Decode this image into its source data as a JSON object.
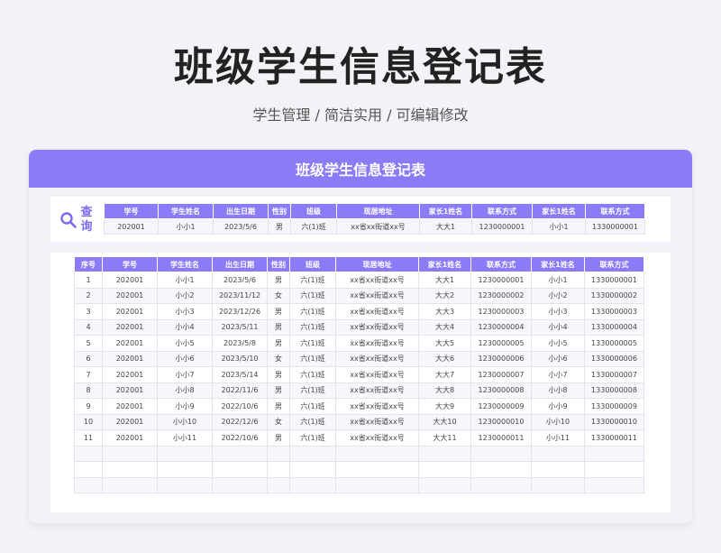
{
  "page": {
    "title": "班级学生信息登记表",
    "subtitle": "学生管理 / 简洁实用 /  可编辑修改"
  },
  "card": {
    "title": "班级学生信息登记表"
  },
  "query": {
    "label": "查询",
    "headers": [
      "学号",
      "学生姓名",
      "出生日期",
      "性别",
      "班级",
      "现居地址",
      "家长1姓名",
      "联系方式",
      "家长1姓名",
      "联系方式"
    ],
    "row": [
      "202001",
      "小小1",
      "2023/5/6",
      "男",
      "六(1)班",
      "xx省xx街道xx号",
      "大大1",
      "1230000001",
      "小小1",
      "1330000001"
    ]
  },
  "table": {
    "headers": [
      "序号",
      "学号",
      "学生姓名",
      "出生日期",
      "性别",
      "班级",
      "现居地址",
      "家长1姓名",
      "联系方式",
      "家长1姓名",
      "联系方式"
    ],
    "rows": [
      [
        "1",
        "202001",
        "小小1",
        "2023/5/6",
        "男",
        "六(1)班",
        "xx省xx街道xx号",
        "大大1",
        "1230000001",
        "小小1",
        "1330000001"
      ],
      [
        "2",
        "202001",
        "小小2",
        "2023/11/12",
        "女",
        "六(1)班",
        "xx省xx街道xx号",
        "大大2",
        "1230000002",
        "小小2",
        "1330000002"
      ],
      [
        "3",
        "202001",
        "小小3",
        "2023/12/26",
        "男",
        "六(1)班",
        "xx省xx街道xx号",
        "大大3",
        "1230000003",
        "小小3",
        "1330000003"
      ],
      [
        "4",
        "202001",
        "小小4",
        "2023/5/11",
        "男",
        "六(1)班",
        "xx省xx街道xx号",
        "大大4",
        "1230000004",
        "小小4",
        "1330000004"
      ],
      [
        "5",
        "202001",
        "小小5",
        "2023/5/8",
        "男",
        "六(1)班",
        "xx省xx街道xx号",
        "大大5",
        "1230000005",
        "小小5",
        "1330000005"
      ],
      [
        "6",
        "202001",
        "小小6",
        "2023/5/10",
        "女",
        "六(1)班",
        "xx省xx街道xx号",
        "大大6",
        "1230000006",
        "小小6",
        "1330000006"
      ],
      [
        "7",
        "202001",
        "小小7",
        "2023/5/14",
        "男",
        "六(1)班",
        "xx省xx街道xx号",
        "大大7",
        "1230000007",
        "小小7",
        "1330000007"
      ],
      [
        "8",
        "202001",
        "小小8",
        "2022/11/6",
        "男",
        "六(1)班",
        "xx省xx街道xx号",
        "大大8",
        "1230000008",
        "小小8",
        "1330000008"
      ],
      [
        "9",
        "202001",
        "小小9",
        "2022/10/6",
        "男",
        "六(1)班",
        "xx省xx街道xx号",
        "大大9",
        "1230000009",
        "小小9",
        "1330000009"
      ],
      [
        "10",
        "202001",
        "小小10",
        "2022/12/6",
        "女",
        "六(1)班",
        "xx省xx街道xx号",
        "大大10",
        "1230000010",
        "小小10",
        "1330000010"
      ],
      [
        "11",
        "202001",
        "小小11",
        "2022/10/6",
        "男",
        "六(1)班",
        "xx省xx街道xx号",
        "大大11",
        "1230000011",
        "小小11",
        "1330000011"
      ],
      [
        "",
        "",
        "",
        "",
        "",
        "",
        "",
        "",
        "",
        "",
        ""
      ],
      [
        "",
        "",
        "",
        "",
        "",
        "",
        "",
        "",
        "",
        "",
        ""
      ],
      [
        "",
        "",
        "",
        "",
        "",
        "",
        "",
        "",
        "",
        "",
        ""
      ]
    ]
  },
  "colors": {
    "accent": "#8b7bf7",
    "background": "#f2f3f7"
  },
  "icons": {
    "query": "search-icon"
  }
}
